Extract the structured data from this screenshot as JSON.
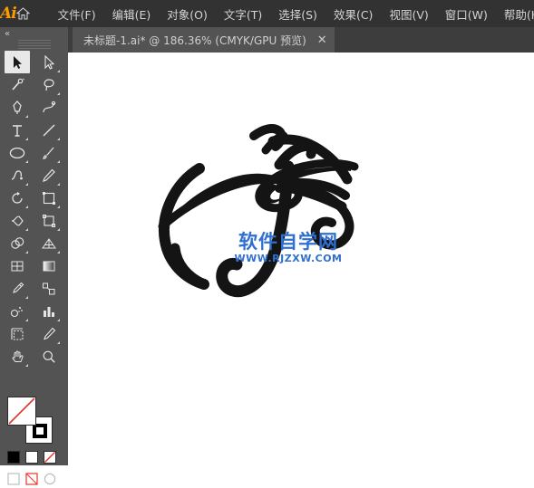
{
  "app": {
    "name": "Adobe Illustrator",
    "logo_text": "Ai",
    "home_icon": "home-icon"
  },
  "menubar": {
    "items": [
      {
        "label": "文件(F)",
        "name": "menu-file"
      },
      {
        "label": "编辑(E)",
        "name": "menu-edit"
      },
      {
        "label": "对象(O)",
        "name": "menu-object"
      },
      {
        "label": "文字(T)",
        "name": "menu-type"
      },
      {
        "label": "选择(S)",
        "name": "menu-select"
      },
      {
        "label": "效果(C)",
        "name": "menu-effect"
      },
      {
        "label": "视图(V)",
        "name": "menu-view"
      },
      {
        "label": "窗口(W)",
        "name": "menu-window"
      },
      {
        "label": "帮助(H)",
        "name": "menu-help"
      }
    ]
  },
  "tabbar": {
    "tab_title": "未标题-1.ai* @ 186.36% (CMYK/GPU 预览)",
    "close_glyph": "✕"
  },
  "toolbar": {
    "collapse_glyph": "«",
    "tools": [
      {
        "name": "selection-tool",
        "label": "选择工具",
        "selected": true
      },
      {
        "name": "direct-selection-tool",
        "label": "直接选择工具",
        "selected": false
      },
      {
        "name": "magic-wand-tool",
        "label": "魔棒工具",
        "selected": false
      },
      {
        "name": "lasso-tool",
        "label": "套索工具",
        "selected": false
      },
      {
        "name": "pen-tool",
        "label": "钢笔工具",
        "selected": false
      },
      {
        "name": "curvature-tool",
        "label": "曲率工具",
        "selected": false
      },
      {
        "name": "type-tool",
        "label": "文字工具",
        "selected": false
      },
      {
        "name": "line-segment-tool",
        "label": "直线段工具",
        "selected": false
      },
      {
        "name": "ellipse-tool",
        "label": "椭圆工具",
        "selected": false
      },
      {
        "name": "paintbrush-tool",
        "label": "画笔工具",
        "selected": false
      },
      {
        "name": "shaper-tool",
        "label": "Shaper 工具",
        "selected": false
      },
      {
        "name": "pencil-tool",
        "label": "铅笔工具",
        "selected": false
      },
      {
        "name": "rotate-tool",
        "label": "旋转工具",
        "selected": false
      },
      {
        "name": "scale-tool",
        "label": "比例缩放工具",
        "selected": false
      },
      {
        "name": "width-tool",
        "label": "宽度工具",
        "selected": false
      },
      {
        "name": "free-transform-tool",
        "label": "自由变换工具",
        "selected": false
      },
      {
        "name": "shape-builder-tool",
        "label": "形状生成器工具",
        "selected": false
      },
      {
        "name": "perspective-grid-tool",
        "label": "透视网格工具",
        "selected": false
      },
      {
        "name": "mesh-tool",
        "label": "网格工具",
        "selected": false
      },
      {
        "name": "gradient-tool",
        "label": "渐变工具",
        "selected": false
      },
      {
        "name": "eyedropper-tool",
        "label": "吸管工具",
        "selected": false
      },
      {
        "name": "blend-tool",
        "label": "混合工具",
        "selected": false
      },
      {
        "name": "symbol-sprayer-tool",
        "label": "符号喷枪工具",
        "selected": false
      },
      {
        "name": "column-graph-tool",
        "label": "柱形图工具",
        "selected": false
      },
      {
        "name": "artboard-tool",
        "label": "画板工具",
        "selected": false
      },
      {
        "name": "slice-tool",
        "label": "切片工具",
        "selected": false
      },
      {
        "name": "hand-tool",
        "label": "抓手工具",
        "selected": false
      },
      {
        "name": "zoom-tool",
        "label": "缩放工具",
        "selected": false
      }
    ],
    "fill_stroke": {
      "fill_name": "fill-swatch",
      "stroke_name": "stroke-swatch",
      "fill_color": "#ffffff",
      "stroke_color": "#000000",
      "none_indicator_color": "#ff0000"
    },
    "color_modes": [
      {
        "name": "color-swatch-button",
        "color": "#000000"
      },
      {
        "name": "gradient-swatch-button",
        "color": "#ffffff"
      },
      {
        "name": "none-swatch-button",
        "color": "#ff0000"
      }
    ],
    "screen_modes": [
      {
        "name": "drawing-mode-normal"
      },
      {
        "name": "drawing-mode-behind"
      },
      {
        "name": "screen-mode-button"
      }
    ]
  },
  "canvas": {
    "name": "artboard-canvas",
    "background": "#ffffff",
    "artwork_name": "brush-stroke-artwork",
    "artwork_color": "#111111",
    "watermark": {
      "main": "软件自学网",
      "sub": "WWW.RJZXW.COM",
      "color": "#2f6fd0"
    }
  }
}
